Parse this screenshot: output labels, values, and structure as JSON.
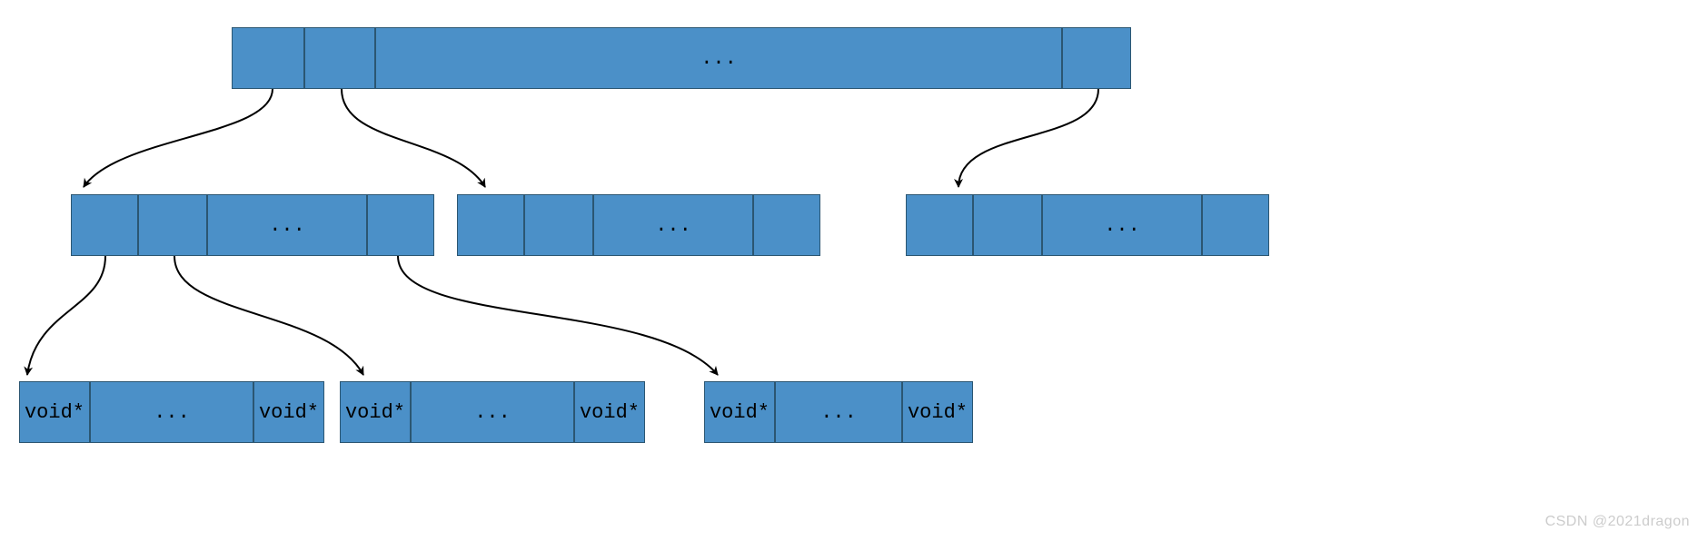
{
  "ellipsis": "...",
  "void_ptr": "void*",
  "watermark": "CSDN @2021dragon",
  "structure": {
    "level0": {
      "cells": [
        "",
        "",
        "...",
        ""
      ]
    },
    "level1": [
      {
        "cells": [
          "",
          "",
          "...",
          ""
        ]
      },
      {
        "cells": [
          "",
          "",
          "...",
          ""
        ]
      },
      {
        "cells": [
          "",
          "",
          "...",
          ""
        ]
      }
    ],
    "level2": [
      {
        "cells": [
          "void*",
          "...",
          "void*"
        ]
      },
      {
        "cells": [
          "void*",
          "...",
          "void*"
        ]
      },
      {
        "cells": [
          "void*",
          "...",
          "void*"
        ]
      }
    ]
  },
  "colors": {
    "block_fill": "#4b90c8",
    "block_border": "#2b5672",
    "background": "#ffffff",
    "arrow": "#000000"
  }
}
